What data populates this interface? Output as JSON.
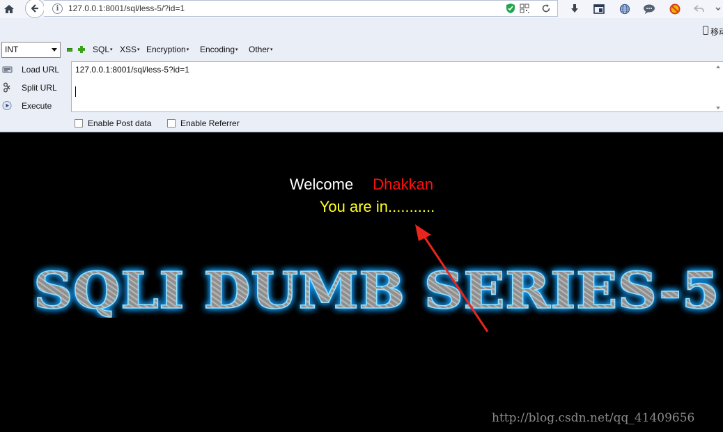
{
  "browser": {
    "address_url": "127.0.0.1:8001/sql/less-5/?id=1",
    "mobile_label": "移动"
  },
  "hackbar": {
    "type_select_value": "INT",
    "menus": [
      "SQL",
      "XSS",
      "Encryption",
      "Encoding",
      "Other"
    ],
    "actions": {
      "load_url": "Load URL",
      "split_url": "Split URL",
      "execute": "Execute"
    },
    "url_input": "127.0.0.1:8001/sql/less-5?id=1",
    "post_data_label": "Enable Post data",
    "referrer_label": "Enable Referrer"
  },
  "page": {
    "welcome": "Welcome",
    "user": "Dhakkan",
    "status": "You are in...........",
    "banner": "SQLI DUMB SERIES-5",
    "watermark": "http://blog.csdn.net/qq_41409656"
  },
  "colors": {
    "user": "#ff1010",
    "status": "#ffff22",
    "banner_glow": "#1aa0ff",
    "arrow": "#e8261e"
  }
}
